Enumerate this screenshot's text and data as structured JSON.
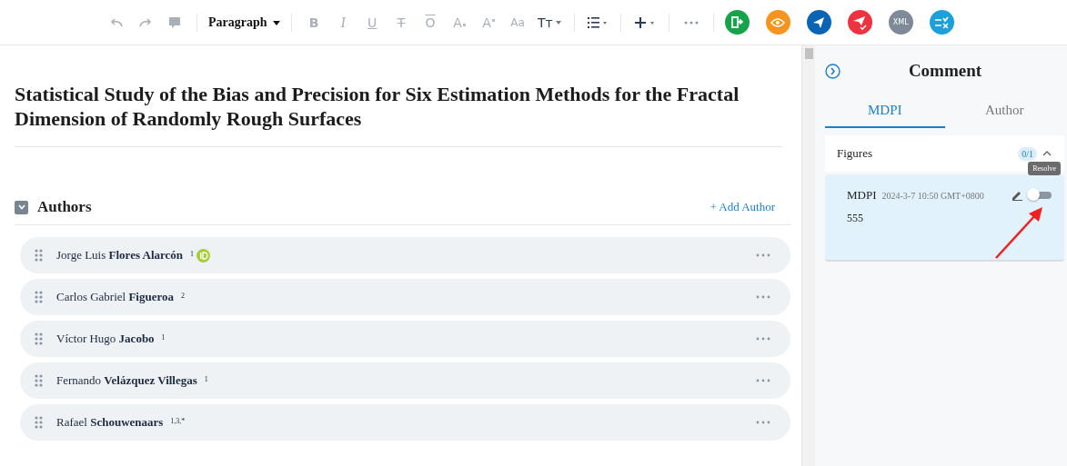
{
  "toolbar": {
    "history": [
      {
        "kind": "undo",
        "disabled": true
      },
      {
        "kind": "redo",
        "disabled": true
      },
      {
        "kind": "comment",
        "disabled": true
      }
    ],
    "block_style": {
      "label": "Paragraph"
    },
    "format": [
      {
        "label": "B",
        "kind": "bold",
        "disabled": true
      },
      {
        "label": "I",
        "kind": "italic",
        "disabled": true
      },
      {
        "label": "U",
        "kind": "underline",
        "disabled": true
      },
      {
        "label": "T",
        "kind": "strike",
        "disabled": true
      },
      {
        "label": "O",
        "kind": "overline",
        "disabled": true
      },
      {
        "label": "A",
        "kind": "sub",
        "disabled": true
      },
      {
        "label": "A",
        "kind": "sup",
        "disabled": true
      },
      {
        "label": "Aa",
        "kind": "case",
        "disabled": true
      },
      {
        "label": "Tт",
        "kind": "size",
        "disabled": false
      }
    ],
    "actions": [
      {
        "kind": "document",
        "color": "#16a34a"
      },
      {
        "kind": "eye",
        "color": "#f7941d"
      },
      {
        "kind": "send",
        "color": "#0b63b5"
      },
      {
        "kind": "send-check",
        "color": "#ee3340"
      },
      {
        "kind": "text",
        "label": "XML",
        "color": "#7e8a97"
      },
      {
        "kind": "compare",
        "color": "#1ba0dc"
      }
    ]
  },
  "document": {
    "title": "Statistical Study of the Bias and Precision for Six Estimation Methods for the Fractal Dimension of Randomly Rough Surfaces",
    "authors_section": {
      "heading": "Authors",
      "expanded": true,
      "add_label": "+ Add Author",
      "authors": [
        {
          "name": "Jorge Luis **Flores Alarcón**",
          "affiliation": "1",
          "orcid": true
        },
        {
          "name": "Carlos Gabriel **Figueroa**",
          "affiliation": "2",
          "orcid": false
        },
        {
          "name": "Víctor Hugo **Jacobo**",
          "affiliation": "1",
          "orcid": false
        },
        {
          "name": "Fernando **Velázquez Villegas**",
          "affiliation": "1",
          "orcid": false
        },
        {
          "name": "Rafael **Schouwenaars**",
          "affiliation": "1,3,*",
          "orcid": false
        }
      ]
    }
  },
  "comment_panel": {
    "title": "Comment",
    "tabs": [
      {
        "label": "MDPI",
        "selected": true
      },
      {
        "label": "Author",
        "selected": false
      }
    ],
    "group": {
      "label": "Figures",
      "count": "0/1",
      "expanded": true
    },
    "comments": [
      {
        "author": "MDPI",
        "time": "2024-3-7 10:50 GMT+0800",
        "text": "555",
        "resolved": false,
        "tooltip": "Resolve"
      }
    ]
  }
}
